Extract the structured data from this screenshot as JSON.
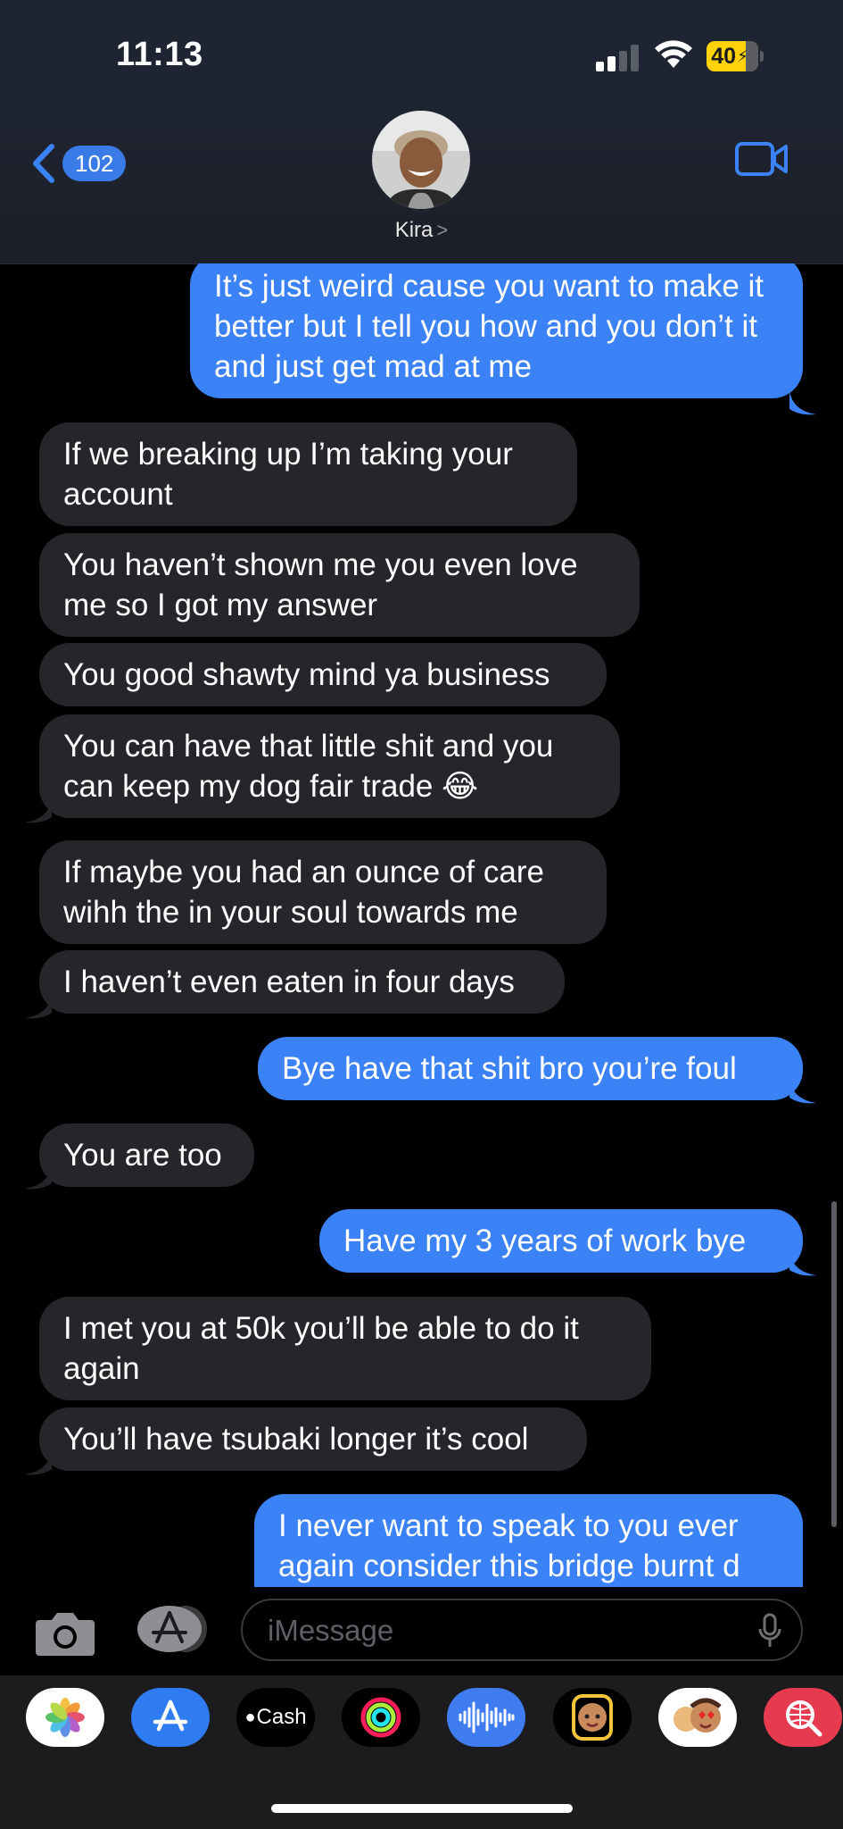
{
  "status": {
    "time": "11:13",
    "battery": "40"
  },
  "header": {
    "back_count": "102",
    "contact_name": "Kira",
    "chevron": ">"
  },
  "messages": [
    {
      "dir": "out",
      "text": "It’s just weird cause you want to make it better but I tell you how and you don’t it and just get mad at me"
    },
    {
      "dir": "in",
      "text": "If we breaking up I’m taking your account"
    },
    {
      "dir": "in",
      "text": "You haven’t shown me you even love me so I got my answer"
    },
    {
      "dir": "in",
      "text": "You good shawty mind ya business"
    },
    {
      "dir": "in",
      "text": "You can have that little shit and you can keep my dog fair trade 😂"
    },
    {
      "dir": "in",
      "text": "If maybe you had an ounce of care wihh the in your soul towards me"
    },
    {
      "dir": "in",
      "text": "I haven’t even eaten in four days"
    },
    {
      "dir": "out",
      "text": "Bye have that shit bro you’re foul"
    },
    {
      "dir": "in",
      "text": "You are too"
    },
    {
      "dir": "out",
      "text": "Have my 3 years of work bye"
    },
    {
      "dir": "in",
      "text": "I met you at 50k you’ll be able to do it again"
    },
    {
      "dir": "in",
      "text": "You’ll have tsubaki longer it’s cool"
    },
    {
      "dir": "out",
      "text": "I never want to speak to you ever again consider this bridge burnt d"
    }
  ],
  "input": {
    "placeholder": "iMessage"
  },
  "drawer": {
    "apps": [
      {
        "name": "photos-app-icon"
      },
      {
        "name": "app-store-icon"
      },
      {
        "name": "apple-cash-icon",
        "label": "Cash"
      },
      {
        "name": "activity-icon"
      },
      {
        "name": "audio-message-icon"
      },
      {
        "name": "memoji-icon"
      },
      {
        "name": "memoji-stickers-icon"
      },
      {
        "name": "web-search-icon"
      }
    ]
  }
}
